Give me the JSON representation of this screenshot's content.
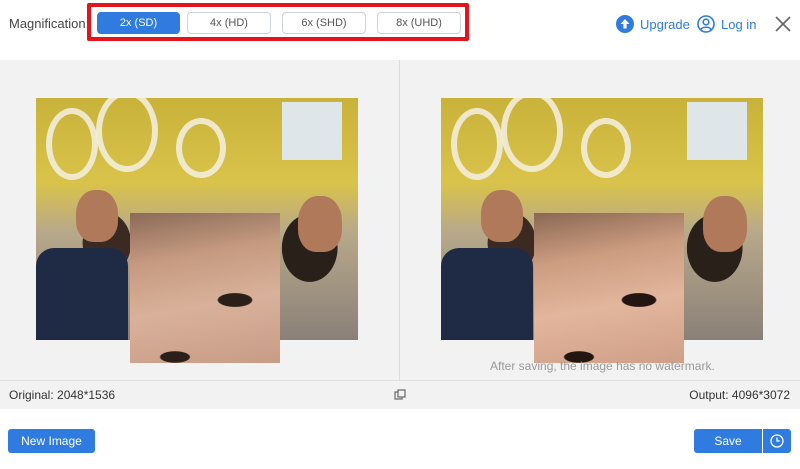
{
  "toolbar": {
    "magnification_label": "Magnification:",
    "options": [
      {
        "label": "2x (SD)",
        "selected": true
      },
      {
        "label": "4x (HD)",
        "selected": false
      },
      {
        "label": "6x (SHD)",
        "selected": false
      },
      {
        "label": "8x (UHD)",
        "selected": false
      }
    ],
    "upgrade_label": "Upgrade",
    "upgrade_icon": "upgrade-arrow-icon",
    "login_label": "Log in",
    "login_icon": "user-icon",
    "close_icon": "close-icon",
    "accent_color": "#2f7be0",
    "highlight_color": "#e3141b"
  },
  "preview": {
    "watermark_note": "After saving, the image has no watermark."
  },
  "infobar": {
    "original_text": "Original: 2048*1536",
    "output_text": "Output: 4096*3072",
    "compare_icon": "compare-icon"
  },
  "bottom": {
    "new_image_label": "New Image",
    "save_label": "Save",
    "history_icon": "clock-icon"
  }
}
